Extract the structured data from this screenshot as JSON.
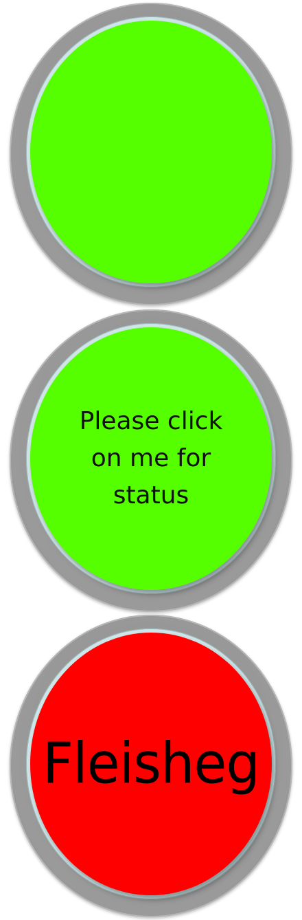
{
  "buttons": [
    {
      "color": "#55ff00",
      "label": ""
    },
    {
      "color": "#55ff00",
      "label": "Please click on me for status"
    },
    {
      "color": "#ff0000",
      "label": "Fleisheg"
    }
  ]
}
